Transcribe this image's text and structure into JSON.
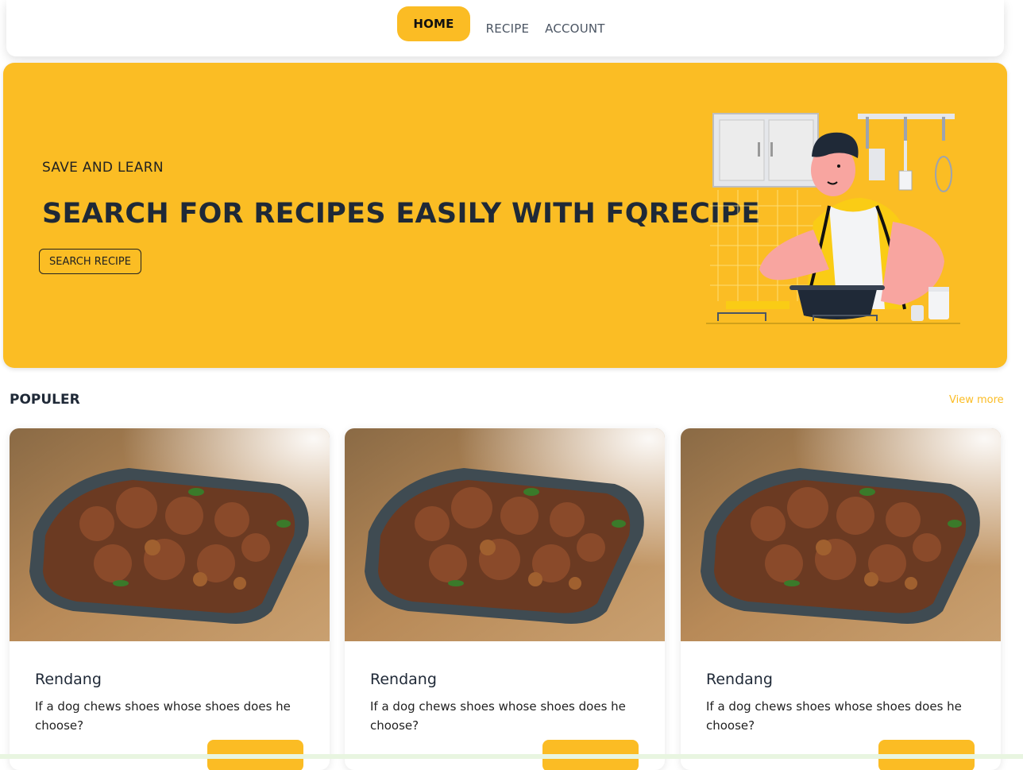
{
  "nav": {
    "items": [
      {
        "label": "HOME",
        "active": true
      },
      {
        "label": "RECIPE",
        "active": false
      },
      {
        "label": "ACCOUNT",
        "active": false
      }
    ]
  },
  "hero": {
    "eyebrow": "SAVE AND LEARN",
    "title": "SEARCH FOR RECIPES EASILY WITH FQRECIPE",
    "button_label": "SEARCH RECIPE",
    "illustration": "chef-cooking-illustration"
  },
  "popular": {
    "title": "POPULER",
    "view_more": "View more",
    "cards": [
      {
        "title": "Rendang",
        "description": "If a dog chews shoes whose shoes does he choose?"
      },
      {
        "title": "Rendang",
        "description": "If a dog chews shoes whose shoes does he choose?"
      },
      {
        "title": "Rendang",
        "description": "If a dog chews shoes whose shoes does he choose?"
      }
    ]
  },
  "colors": {
    "accent": "#fbbc24",
    "text": "#1f2937"
  }
}
